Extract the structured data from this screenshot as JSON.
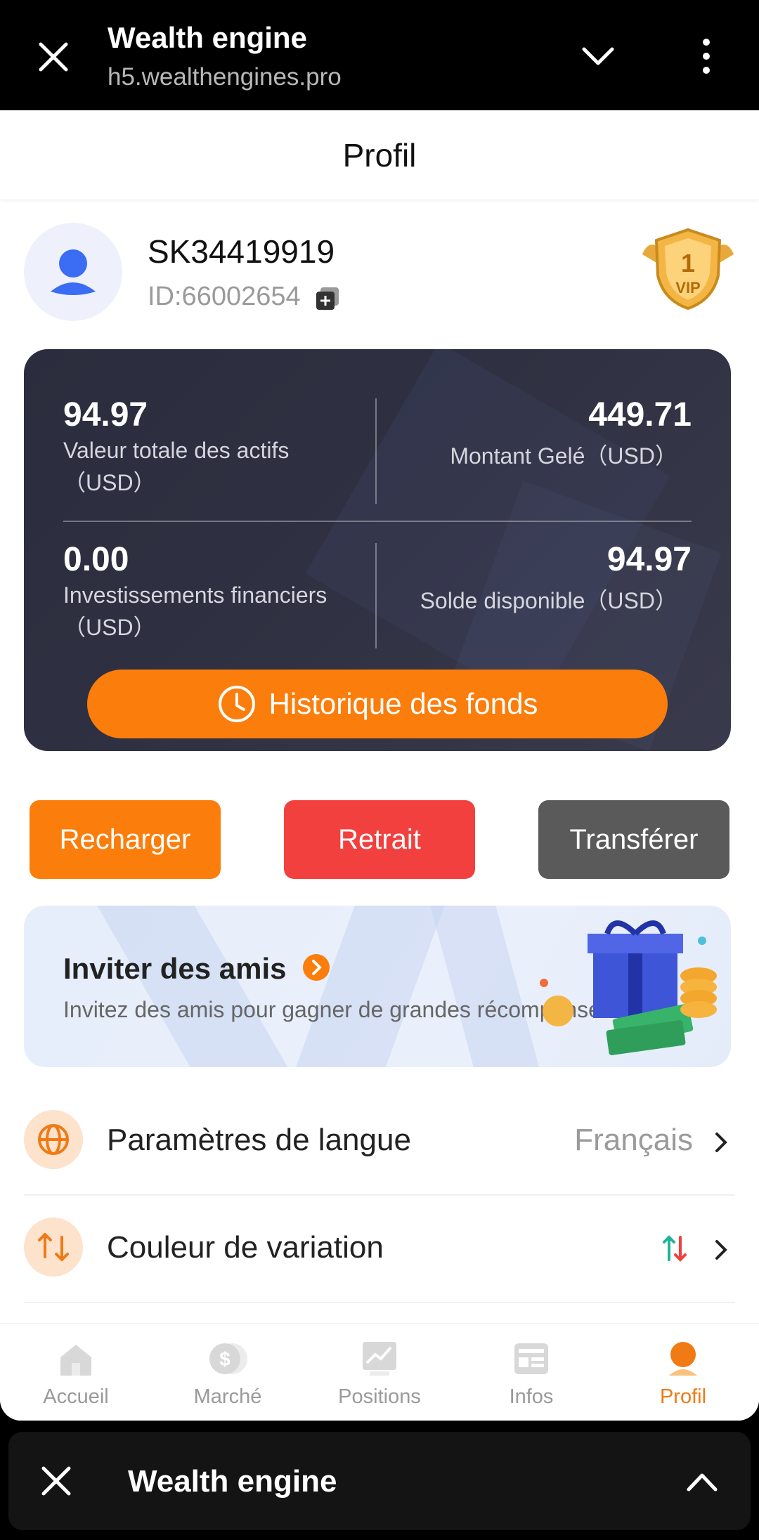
{
  "browser": {
    "title": "Wealth engine",
    "url": "h5.wealthengines.pro"
  },
  "page": {
    "title": "Profil"
  },
  "user": {
    "name": "SK34419919",
    "id": "ID:66002654",
    "vip_level": "1",
    "vip_label": "VIP"
  },
  "assets": {
    "total_value": "94.97",
    "total_label": "Valeur totale des actifs",
    "total_unit": "（USD）",
    "frozen_value": "449.71",
    "frozen_label": "Montant Gelé（USD）",
    "invest_value": "0.00",
    "invest_label": "Investissements financiers",
    "invest_unit": "（USD）",
    "available_value": "94.97",
    "available_label": "Solde disponible（USD）",
    "history_button": "Historique des fonds"
  },
  "actions": {
    "recharge": "Recharger",
    "withdraw": "Retrait",
    "transfer": "Transférer"
  },
  "invite": {
    "title": "Inviter des amis",
    "subtitle": "Invitez des amis pour gagner de grandes récompenses !"
  },
  "settings": [
    {
      "label": "Paramètres de langue",
      "value": "Français",
      "icon": "globe-icon"
    },
    {
      "label": "Couleur de variation",
      "value": "",
      "icon": "swap-icon"
    }
  ],
  "tabs": [
    {
      "label": "Accueil",
      "icon": "home-icon"
    },
    {
      "label": "Marché",
      "icon": "market-icon"
    },
    {
      "label": "Positions",
      "icon": "positions-icon"
    },
    {
      "label": "Infos",
      "icon": "news-icon"
    },
    {
      "label": "Profil",
      "icon": "profile-icon",
      "active": true
    }
  ],
  "bottom_bar": {
    "title": "Wealth engine"
  },
  "colors": {
    "accent_orange": "#fb7d0b",
    "withdraw_red": "#f2403e",
    "transfer_gray": "#5a5a5a",
    "card_dark": "#2f3142",
    "active_tab": "#f07a14"
  }
}
